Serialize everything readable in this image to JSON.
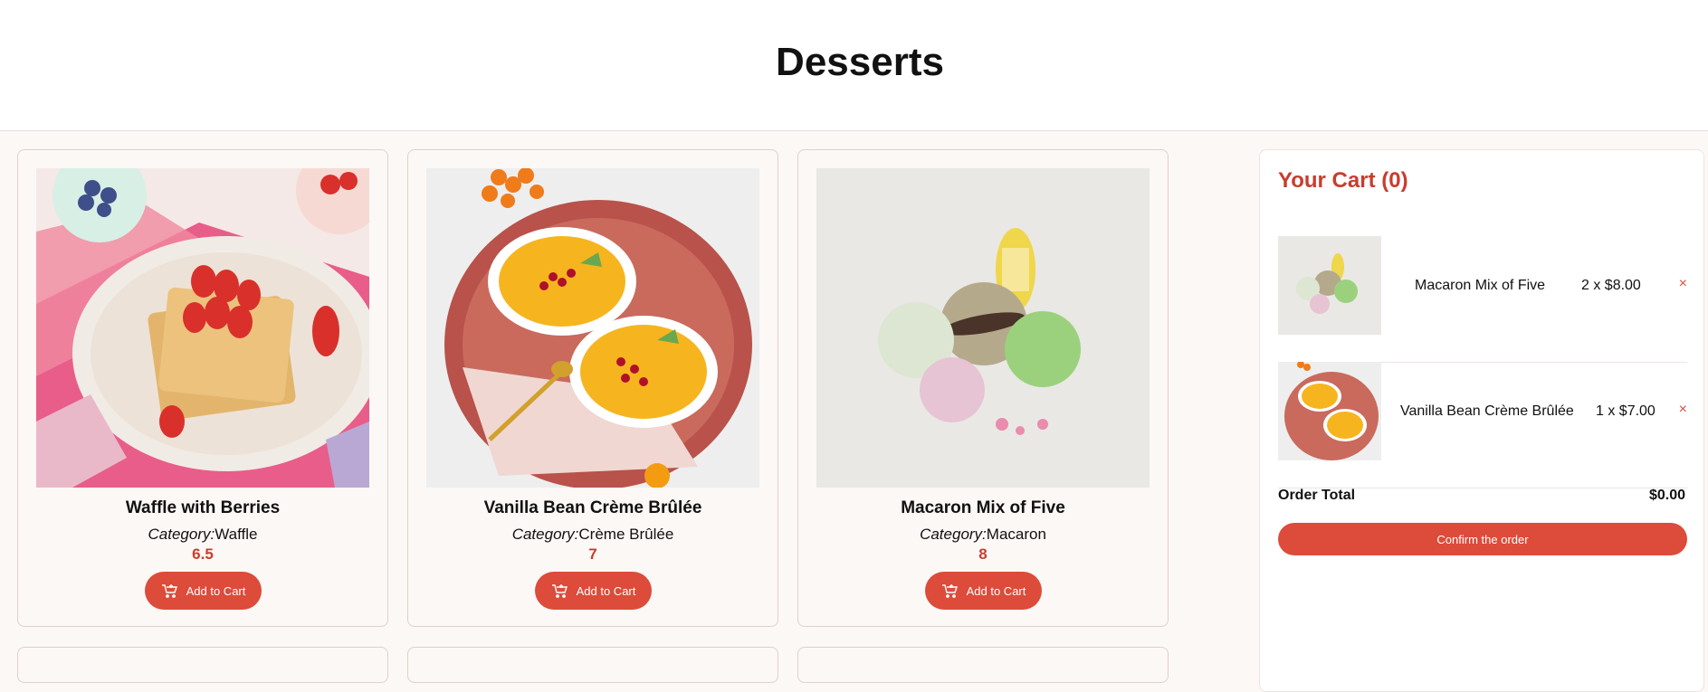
{
  "page": {
    "title": "Desserts"
  },
  "products": [
    {
      "name": "Waffle with Berries",
      "category_label": "Category:",
      "category": "Waffle",
      "price": "6.5",
      "button_label": "Add to Cart"
    },
    {
      "name": "Vanilla Bean Crème Brûlée",
      "category_label": "Category:",
      "category": "Crème Brûlée",
      "price": "7",
      "button_label": "Add to Cart"
    },
    {
      "name": "Macaron Mix of Five",
      "category_label": "Category:",
      "category": "Macaron",
      "price": "8",
      "button_label": "Add to Cart"
    }
  ],
  "cart": {
    "title": "Your Cart (0)",
    "items": [
      {
        "name": "Macaron Mix of Five",
        "qty_price": "2 x $8.00",
        "remove": "×"
      },
      {
        "name": "Vanilla Bean Crème Brûlée",
        "qty_price": "1 x $7.00",
        "remove": "×"
      }
    ],
    "order_total_label": "Order Total",
    "order_total_value": "$0.00",
    "confirm_label": "Confirm the order"
  },
  "colors": {
    "accent": "#dd4b3a",
    "accent_text": "#c83d2e",
    "background": "#fcf8f6"
  },
  "icons": {
    "add_to_cart": "cart-plus-icon",
    "remove": "close-icon"
  }
}
